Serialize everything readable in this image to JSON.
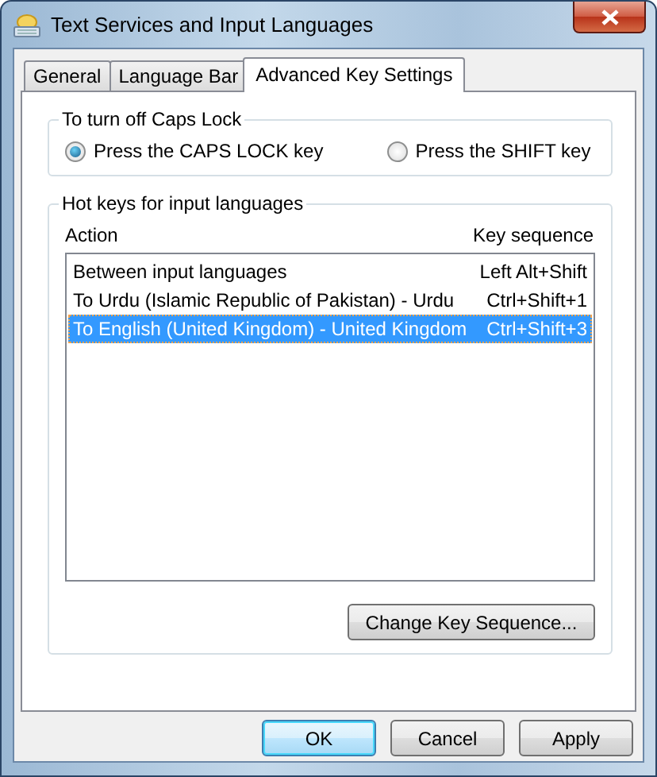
{
  "window": {
    "title": "Text Services and Input Languages"
  },
  "tabs": [
    {
      "label": "General",
      "selected": false
    },
    {
      "label": "Language Bar",
      "selected": false
    },
    {
      "label": "Advanced Key Settings",
      "selected": true
    }
  ],
  "caps_lock": {
    "title": "To turn off Caps Lock",
    "options": [
      {
        "label": "Press the CAPS LOCK key",
        "selected": true
      },
      {
        "label": "Press the SHIFT key",
        "selected": false
      }
    ]
  },
  "hot_keys": {
    "title": "Hot keys for input languages",
    "columns": [
      "Action",
      "Key sequence"
    ],
    "rows": [
      {
        "action": "Between input languages",
        "key_sequence": "Left Alt+Shift",
        "selected": false
      },
      {
        "action": "To Urdu (Islamic Republic of Pakistan) - Urdu",
        "key_sequence": "Ctrl+Shift+1",
        "selected": false
      },
      {
        "action": "To English (United Kingdom) - United Kingdom",
        "key_sequence": "Ctrl+Shift+3",
        "selected": true
      }
    ],
    "button": "Change Key Sequence..."
  },
  "buttons": [
    {
      "label": "OK",
      "default": true
    },
    {
      "label": "Cancel",
      "default": false
    },
    {
      "label": "Apply",
      "default": false
    }
  ]
}
